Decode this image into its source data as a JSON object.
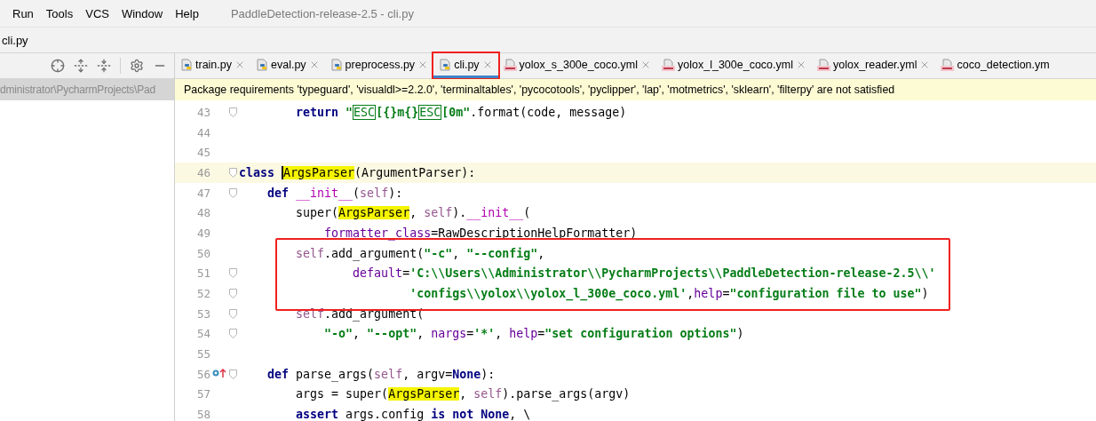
{
  "menu": [
    "Run",
    "Tools",
    "VCS",
    "Window",
    "Help"
  ],
  "window": {
    "title": "PaddleDetection-release-2.5 - cli.py"
  },
  "breadcrumb": "cli.py",
  "project_panel": {
    "selected_row": "dministrator\\PycharmProjects\\Pad"
  },
  "tabs": [
    {
      "label": "train.py",
      "kind": "py",
      "selected": false,
      "closable": true,
      "boxed": false
    },
    {
      "label": "eval.py",
      "kind": "py",
      "selected": false,
      "closable": true,
      "boxed": false
    },
    {
      "label": "preprocess.py",
      "kind": "py",
      "selected": false,
      "closable": true,
      "boxed": false
    },
    {
      "label": "cli.py",
      "kind": "py",
      "selected": true,
      "closable": true,
      "boxed": true
    },
    {
      "label": "yolox_s_300e_coco.yml",
      "kind": "yml",
      "selected": false,
      "closable": true,
      "boxed": false
    },
    {
      "label": "yolox_l_300e_coco.yml",
      "kind": "yml",
      "selected": false,
      "closable": true,
      "boxed": false
    },
    {
      "label": "yolox_reader.yml",
      "kind": "yml",
      "selected": false,
      "closable": true,
      "boxed": false
    },
    {
      "label": "coco_detection.ym",
      "kind": "yml",
      "selected": false,
      "closable": false,
      "boxed": false
    }
  ],
  "notification": "Package requirements 'typeguard', 'visualdl>=2.2.0', 'terminaltables', 'pycocotools', 'pyclipper', 'lap', 'motmetrics', 'sklearn', 'filterpy' are not satisfied",
  "code_lines": [
    {
      "number": "43",
      "fold": true,
      "current": false,
      "boxed": false,
      "override": false,
      "tokens": [
        {
          "kind": "kw",
          "text": "        return "
        },
        {
          "kind": "str",
          "text": "\""
        },
        {
          "kind": "esc",
          "text": "ESC"
        },
        {
          "kind": "str",
          "text": "[{}m{}"
        },
        {
          "kind": "esc",
          "text": "ESC"
        },
        {
          "kind": "str",
          "text": "[0m\""
        },
        {
          "kind": "plain",
          "text": ".format(code, message)"
        }
      ]
    },
    {
      "number": "44",
      "fold": false,
      "current": false,
      "boxed": false,
      "override": false
    },
    {
      "number": "45",
      "fold": false,
      "current": false,
      "boxed": false,
      "override": false
    },
    {
      "number": "46",
      "fold": true,
      "current": true,
      "boxed": false,
      "override": false,
      "tokens": [
        {
          "kind": "kw",
          "text": "class "
        },
        {
          "kind": "hl",
          "text": "ArgsParser",
          "caret": true
        },
        {
          "kind": "plain",
          "text": "(ArgumentParser):"
        }
      ]
    },
    {
      "number": "47",
      "fold": true,
      "current": false,
      "boxed": false,
      "override": false,
      "tokens": [
        {
          "kind": "kw",
          "text": "    def "
        },
        {
          "kind": "magic",
          "text": "__init__"
        },
        {
          "kind": "plain",
          "text": "("
        },
        {
          "kind": "self",
          "text": "self"
        },
        {
          "kind": "plain",
          "text": "):"
        }
      ]
    },
    {
      "number": "48",
      "fold": false,
      "current": false,
      "boxed": false,
      "override": false,
      "tokens": [
        {
          "kind": "plain",
          "text": "        super("
        },
        {
          "kind": "hl",
          "text": "ArgsParser"
        },
        {
          "kind": "plain",
          "text": ", "
        },
        {
          "kind": "self",
          "text": "self"
        },
        {
          "kind": "plain",
          "text": ")."
        },
        {
          "kind": "magic",
          "text": "__init__"
        },
        {
          "kind": "plain",
          "text": "("
        }
      ]
    },
    {
      "number": "49",
      "fold": false,
      "current": false,
      "boxed": false,
      "override": false,
      "tokens": [
        {
          "kind": "param",
          "text": "            formatter_class"
        },
        {
          "kind": "plain",
          "text": "=RawDescriptionHelpFormatter)"
        }
      ]
    },
    {
      "number": "50",
      "fold": false,
      "current": false,
      "boxed": true,
      "override": false,
      "tokens": [
        {
          "kind": "self",
          "text": "        self"
        },
        {
          "kind": "plain",
          "text": ".add_argument("
        },
        {
          "kind": "str",
          "text": "\"-c\""
        },
        {
          "kind": "plain",
          "text": ", "
        },
        {
          "kind": "str",
          "text": "\"--config\""
        },
        {
          "kind": "plain",
          "text": ","
        }
      ]
    },
    {
      "number": "51",
      "fold": true,
      "current": false,
      "boxed": true,
      "override": false,
      "tokens": [
        {
          "kind": "param",
          "text": "                default"
        },
        {
          "kind": "plain",
          "text": "="
        },
        {
          "kind": "str",
          "text": "'C:\\\\Users\\\\Administrator\\\\PycharmProjects\\\\PaddleDetection-release-2.5\\\\'"
        }
      ]
    },
    {
      "number": "52",
      "fold": true,
      "current": false,
      "boxed": true,
      "override": false,
      "tokens": [
        {
          "kind": "str",
          "text": "                        'configs\\\\yolox\\\\yolox_l_300e_coco.yml'"
        },
        {
          "kind": "plain",
          "text": ","
        },
        {
          "kind": "param",
          "text": "help"
        },
        {
          "kind": "plain",
          "text": "="
        },
        {
          "kind": "str",
          "text": "\"configuration file to use\""
        },
        {
          "kind": "plain",
          "text": ")"
        }
      ]
    },
    {
      "number": "53",
      "fold": true,
      "current": false,
      "boxed": false,
      "override": false,
      "tokens": [
        {
          "kind": "self",
          "text": "        self"
        },
        {
          "kind": "plain",
          "text": ".add_argument("
        }
      ]
    },
    {
      "number": "54",
      "fold": true,
      "current": false,
      "boxed": false,
      "override": false,
      "tokens": [
        {
          "kind": "str",
          "text": "            \"-o\""
        },
        {
          "kind": "plain",
          "text": ", "
        },
        {
          "kind": "str",
          "text": "\"--opt\""
        },
        {
          "kind": "plain",
          "text": ", "
        },
        {
          "kind": "param",
          "text": "nargs"
        },
        {
          "kind": "plain",
          "text": "="
        },
        {
          "kind": "str",
          "text": "'*'"
        },
        {
          "kind": "plain",
          "text": ", "
        },
        {
          "kind": "param",
          "text": "help"
        },
        {
          "kind": "plain",
          "text": "="
        },
        {
          "kind": "str",
          "text": "\"set configuration options\""
        },
        {
          "kind": "plain",
          "text": ")"
        }
      ]
    },
    {
      "number": "55",
      "fold": false,
      "current": false,
      "boxed": false,
      "override": false
    },
    {
      "number": "56",
      "fold": true,
      "current": false,
      "boxed": false,
      "override": true,
      "tokens": [
        {
          "kind": "kw",
          "text": "    def "
        },
        {
          "kind": "plain",
          "text": "parse_args("
        },
        {
          "kind": "self",
          "text": "self"
        },
        {
          "kind": "plain",
          "text": ", argv="
        },
        {
          "kind": "kw",
          "text": "None"
        },
        {
          "kind": "plain",
          "text": "):"
        }
      ]
    },
    {
      "number": "57",
      "fold": false,
      "current": false,
      "boxed": false,
      "override": false,
      "tokens": [
        {
          "kind": "plain",
          "text": "        args = super("
        },
        {
          "kind": "hl",
          "text": "ArgsParser"
        },
        {
          "kind": "plain",
          "text": ", "
        },
        {
          "kind": "self",
          "text": "self"
        },
        {
          "kind": "plain",
          "text": ").parse_args(argv)"
        }
      ]
    },
    {
      "number": "58",
      "fold": false,
      "current": false,
      "boxed": false,
      "override": false,
      "tokens": [
        {
          "kind": "kw",
          "text": "        assert "
        },
        {
          "kind": "plain",
          "text": "args.config "
        },
        {
          "kind": "kw",
          "text": "is not None"
        },
        {
          "kind": "plain",
          "text": ", \\"
        }
      ]
    }
  ]
}
